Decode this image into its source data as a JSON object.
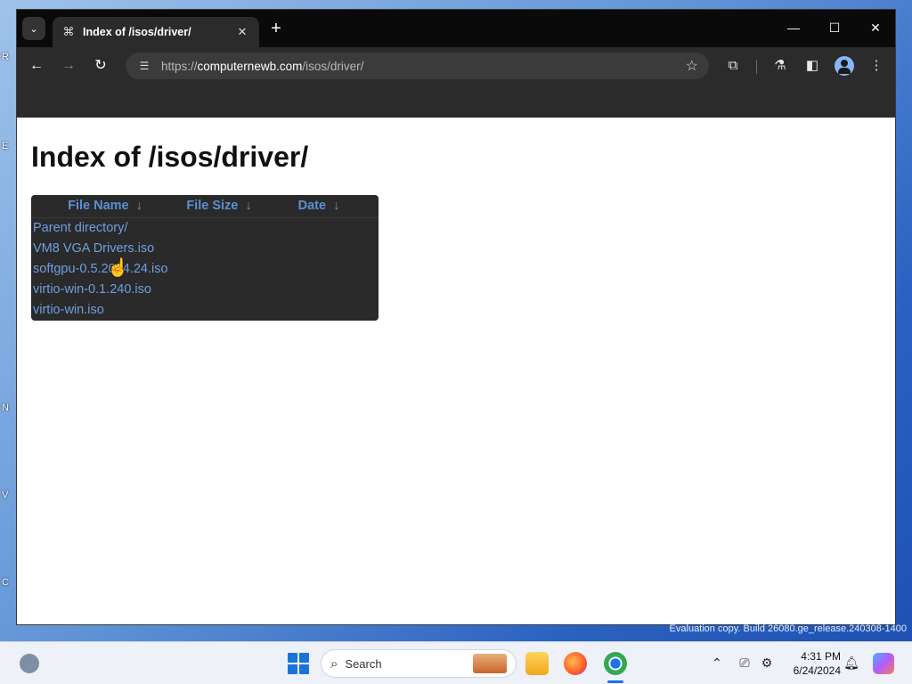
{
  "browser": {
    "tab_title": "Index of /isos/driver/",
    "url_scheme": "https://",
    "url_host": "computernewb.com",
    "url_path": "/isos/driver/",
    "icons": [
      "tab-search-icon",
      "site-favicon",
      "close-icon",
      "new-tab-icon",
      "minimize-icon",
      "maximize-icon",
      "window-close-icon",
      "back-icon",
      "forward-icon",
      "reload-icon",
      "site-info-icon",
      "bookmark-star-icon",
      "extensions-icon",
      "labs-icon",
      "side-panel-icon",
      "profile-icon",
      "menu-icon"
    ]
  },
  "page": {
    "heading": "Index of /isos/driver/",
    "columns": [
      {
        "label": "File Name",
        "arrow": "↓"
      },
      {
        "label": "File Size",
        "arrow": "↓"
      },
      {
        "label": "Date",
        "arrow": "↓"
      }
    ],
    "rows": [
      {
        "name": "Parent directory/",
        "size": "",
        "date": ""
      },
      {
        "name": "VM8 VGA Drivers.iso",
        "size": "",
        "date": ""
      },
      {
        "name": "softgpu-0.5.2024.24.iso",
        "size": "",
        "date": ""
      },
      {
        "name": "virtio-win-0.1.240.iso",
        "size": "",
        "date": ""
      },
      {
        "name": "virtio-win.iso",
        "size": "",
        "date": ""
      }
    ]
  },
  "desktop": {
    "watermark": "Evaluation copy. Build 26080.ge_release.240308-1400"
  },
  "taskbar": {
    "search_label": "Search",
    "time": "4:31 PM",
    "date": "6/24/2024"
  },
  "colors": {
    "link": "#6f9ee0",
    "header_link": "#5a8fd6",
    "table_bg": "#2a2a2a",
    "chrome_dark": "#2b2b2b"
  }
}
